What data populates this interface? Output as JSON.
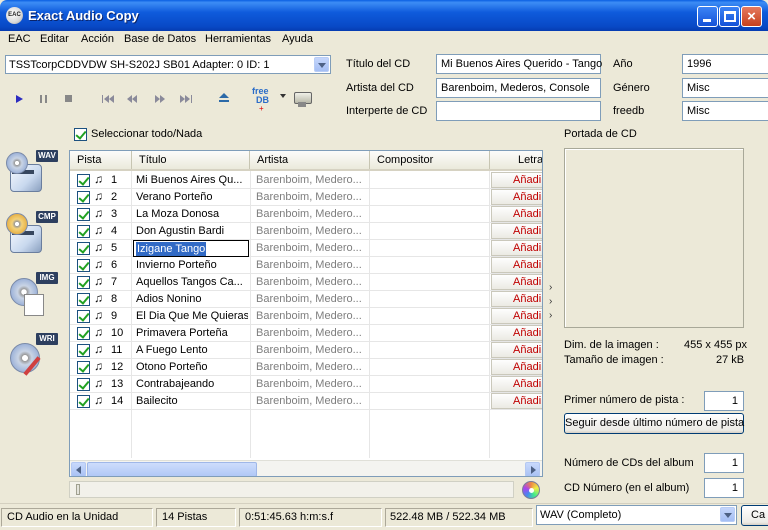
{
  "window": {
    "title": "Exact Audio Copy",
    "icon_text": "EAC"
  },
  "menu": [
    "EAC",
    "Editar",
    "Acción",
    "Base de Datos",
    "Herramientas",
    "Ayuda"
  ],
  "drive": {
    "selected": "TSSTcorpCDDVDW SH-S202J SB01   Adapter: 0  ID: 1"
  },
  "toolbar": {
    "freedb_top": "free",
    "freedb_bottom": "DB"
  },
  "cd_info": {
    "title_label": "Título del CD",
    "title_value": "Mi Buenos Aires Querido - Tango",
    "artist_label": "Artista del CD",
    "artist_value": "Barenboim, Mederos, Console",
    "performer_label": "Interperte de CD",
    "performer_value": "",
    "year_label": "Año",
    "year_value": "1996",
    "genre_label": "Género",
    "genre_value": "Misc",
    "freedb_label": "freedb",
    "freedb_value": "Misc"
  },
  "side_tags": [
    "WAV",
    "CMP",
    "IMG",
    "WRI"
  ],
  "select_all_label": "Seleccionar todo/Nada",
  "columns": [
    "Pista",
    "Título",
    "Artista",
    "Compositor",
    "Letra"
  ],
  "tracks": [
    {
      "num": "1",
      "title": "Mi Buenos Aires Qu...",
      "artist": "Barenboim, Medero...",
      "lyrics": "Añadi"
    },
    {
      "num": "2",
      "title": "Verano Porteño",
      "artist": "Barenboim, Medero...",
      "lyrics": "Añadi"
    },
    {
      "num": "3",
      "title": "La Moza Donosa",
      "artist": "Barenboim, Medero...",
      "lyrics": "Añadi"
    },
    {
      "num": "4",
      "title": "Don Agustin Bardi",
      "artist": "Barenboim, Medero...",
      "lyrics": "Añadi"
    },
    {
      "num": "5",
      "title": "Izigane Tango",
      "artist": "Barenboim, Medero...",
      "lyrics": "Añadi"
    },
    {
      "num": "6",
      "title": "Invierno Porteño",
      "artist": "Barenboim, Medero...",
      "lyrics": "Añadi"
    },
    {
      "num": "7",
      "title": "Aquellos Tangos Ca...",
      "artist": "Barenboim, Medero...",
      "lyrics": "Añadi"
    },
    {
      "num": "8",
      "title": "Adios Nonino",
      "artist": "Barenboim, Medero...",
      "lyrics": "Añadi"
    },
    {
      "num": "9",
      "title": "El Dia Que Me Quieras",
      "artist": "Barenboim, Medero...",
      "lyrics": "Añadi"
    },
    {
      "num": "10",
      "title": "Primavera Porteña",
      "artist": "Barenboim, Medero...",
      "lyrics": "Añadi"
    },
    {
      "num": "11",
      "title": "A Fuego Lento",
      "artist": "Barenboim, Medero...",
      "lyrics": "Añadi"
    },
    {
      "num": "12",
      "title": "Otono Porteño",
      "artist": "Barenboim, Medero...",
      "lyrics": "Añadi"
    },
    {
      "num": "13",
      "title": "Contrabajeando",
      "artist": "Barenboim, Medero...",
      "lyrics": "Añadi"
    },
    {
      "num": "14",
      "title": "Bailecito",
      "artist": "Barenboim, Medero...",
      "lyrics": "Añadi"
    }
  ],
  "cover": {
    "label": "Portada de CD",
    "dim_label": "Dim. de la imagen :",
    "dim_value": "455 x 455 px",
    "size_label": "Tamaño de imagen :",
    "size_value": "27 kB"
  },
  "numbering": {
    "first_track_label": "Primer número de pista :",
    "first_track_value": "1",
    "continue_button": "Seguir desde último número de pista",
    "cd_count_label": "Número de CDs del album",
    "cd_count_value": "1",
    "cd_number_label": "CD Número (en el album)",
    "cd_number_value": "1"
  },
  "status": {
    "drive_state": "CD Audio en la Unidad",
    "tracks": "14 Pistas",
    "duration": "0:51:45.63 h:m:s.f",
    "size": "522.48 MB / 522.34 MB",
    "format": "WAV  (Completo)",
    "cancel_button": "Ca"
  },
  "colors": {
    "titlebar": "#0a55d8",
    "lyrics_link": "#c00000",
    "selection": "#316ac5"
  }
}
